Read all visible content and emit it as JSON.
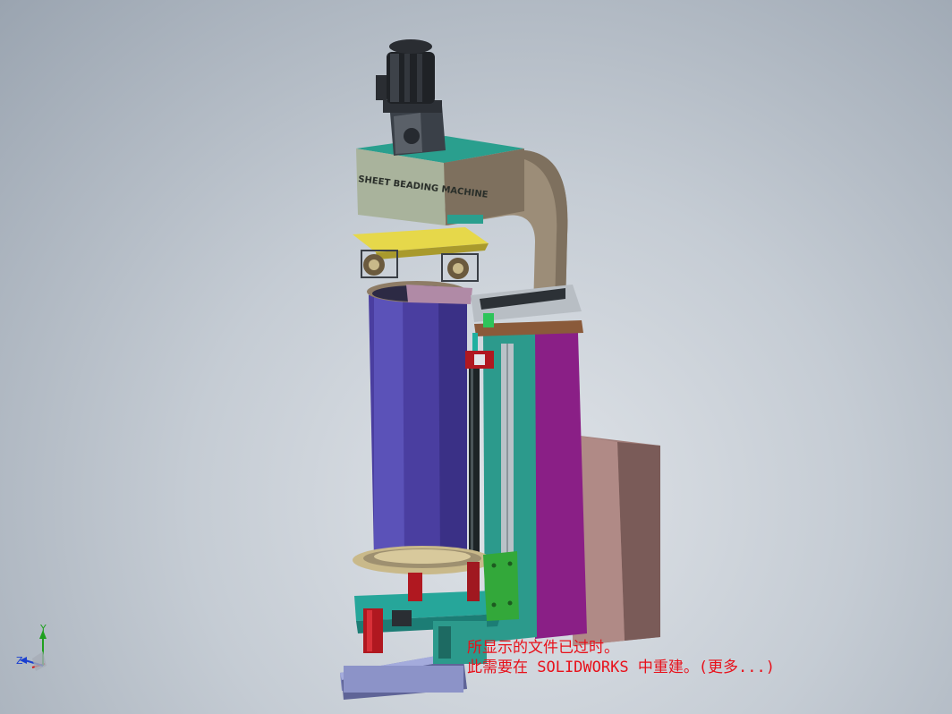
{
  "model": {
    "nameplate_title": "SHEET BEADING MACHINE",
    "nameplate_lines": [
      "",
      "",
      "",
      "",
      ""
    ]
  },
  "notice": {
    "line1": "所显示的文件已过时。",
    "line2": "此需要在 SOLIDWORKS 中重建。(更多...)",
    "color": "#e8101a"
  },
  "triad": {
    "x_label": "",
    "y_label": "Y",
    "z_label": "Z",
    "y_color": "#1fa01f",
    "z_color": "#1a3fd0",
    "x_color": "#d01a1a"
  },
  "colors": {
    "background": "#c5ccd4",
    "frame": "#9c8d78",
    "head": "#2a9f8e",
    "cylinder": "#4a3ea0",
    "column_magenta": "#8a1f86",
    "cabinet": "#a07c78",
    "base": "#8c93c8",
    "clamp_yellow": "#e6d84a"
  }
}
